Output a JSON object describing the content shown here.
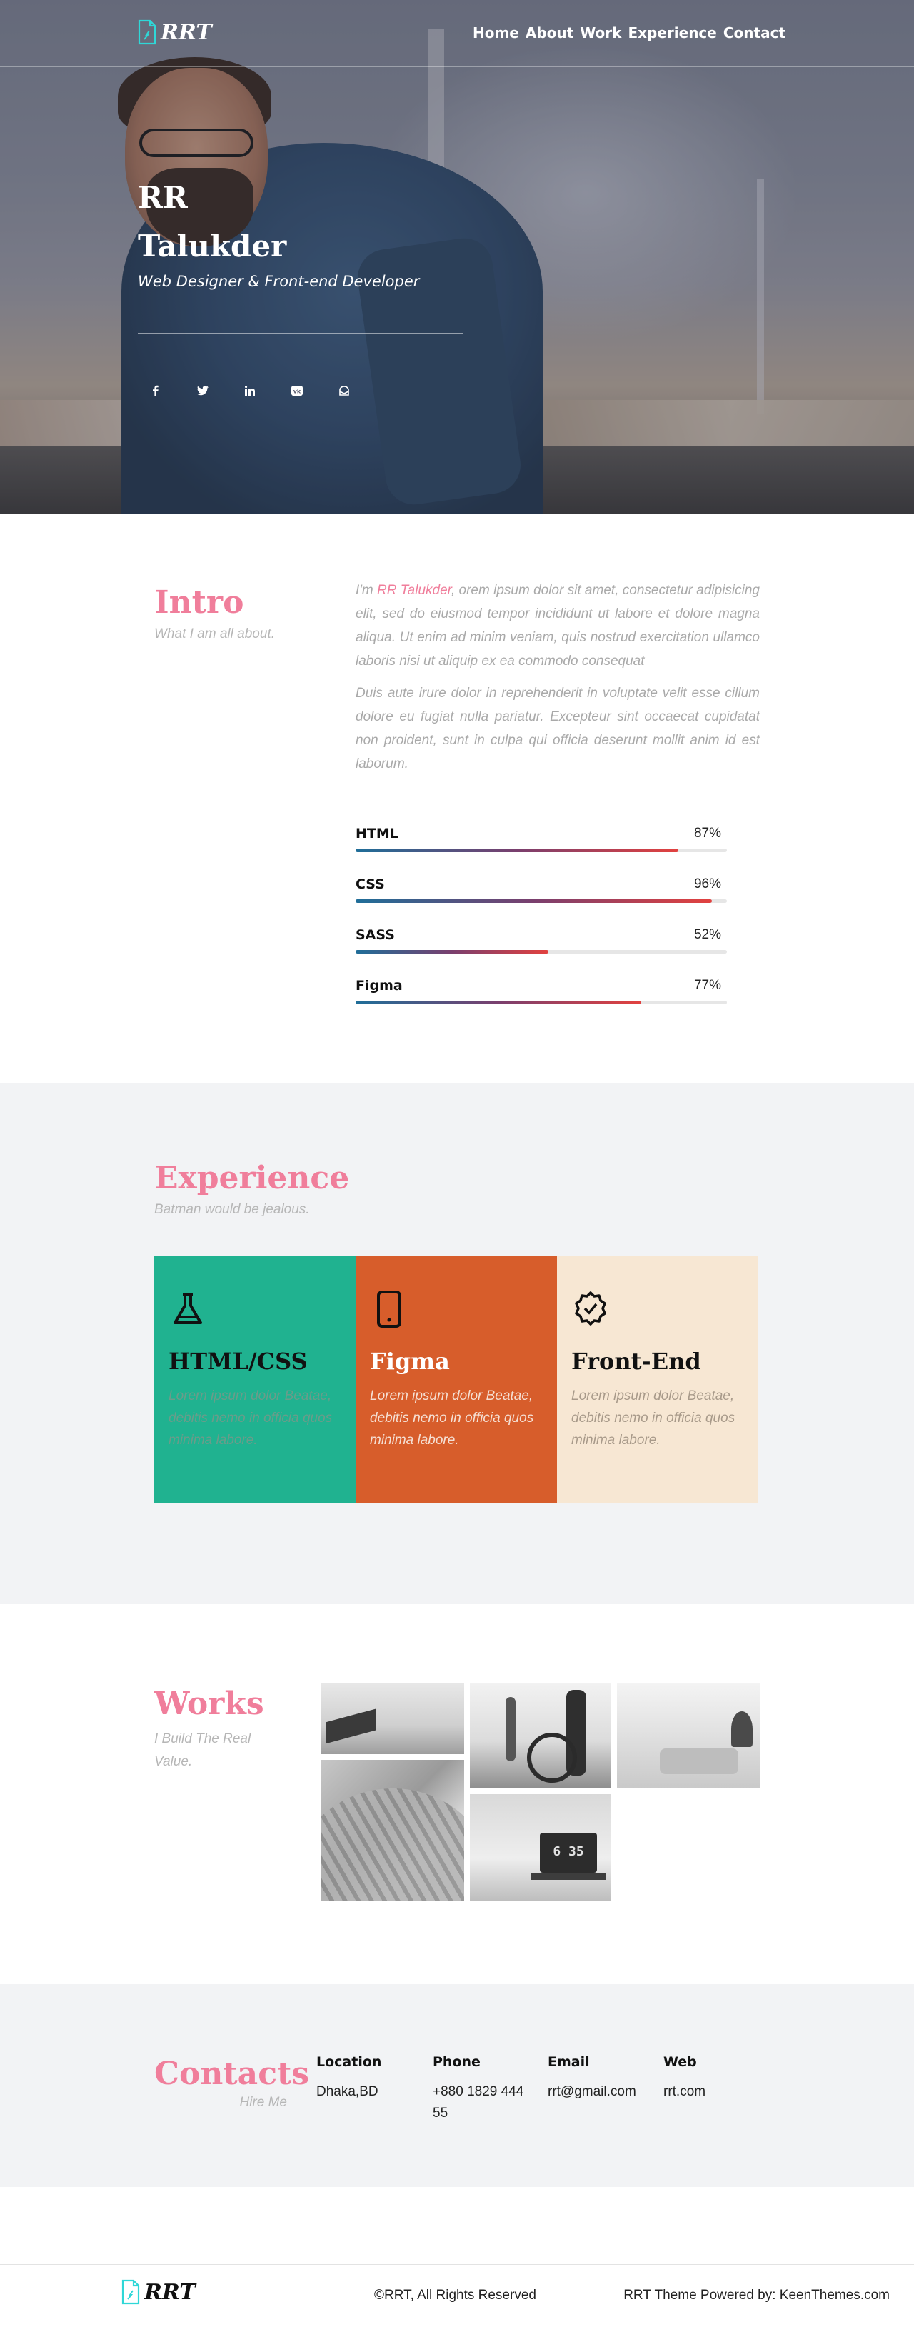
{
  "brand": {
    "logo_text": "RRT",
    "accent": "#f07e9b"
  },
  "nav": {
    "items": [
      "Home",
      "About",
      "Work",
      "Experience",
      "Contact"
    ]
  },
  "hero": {
    "name_line1": "RR",
    "name_line2": "Talukder",
    "role": "Web Designer & Front-end Developer",
    "socials": [
      "facebook-icon",
      "twitter-icon",
      "linkedin-icon",
      "vk-icon",
      "mail-icon"
    ]
  },
  "intro": {
    "title": "Intro",
    "subtitle": "What I am all about.",
    "para1_prefix": "I'm ",
    "para1_highlight": "RR Talukder",
    "para1_rest": ", orem ipsum dolor sit amet, consectetur adipisicing elit, sed do eiusmod tempor incididunt ut labore et dolore magna aliqua. Ut enim ad minim veniam, quis nostrud exercitation ullamco laboris nisi ut aliquip ex ea commodo consequat",
    "para2": "Duis aute irure dolor in reprehenderit in voluptate velit esse cillum dolore eu fugiat nulla pariatur. Excepteur sint occaecat cupidatat non proident, sunt in culpa qui officia deserunt mollit anim id est laborum.",
    "skills": [
      {
        "name": "HTML",
        "percent_label": "87%",
        "value": 87
      },
      {
        "name": "CSS",
        "percent_label": "96%",
        "value": 96
      },
      {
        "name": "SASS",
        "percent_label": "52%",
        "value": 52
      },
      {
        "name": "Figma",
        "percent_label": "77%",
        "value": 77
      }
    ]
  },
  "experience": {
    "title": "Experience",
    "subtitle": "Batman would be jealous.",
    "cards": [
      {
        "icon": "flask-icon",
        "title": "HTML/CSS",
        "text": "Lorem ipsum dolor Beatae, debitis nemo in officia quos minima labore.",
        "color": "#20b290"
      },
      {
        "icon": "tablet-icon",
        "title": "Figma",
        "text": "Lorem ipsum dolor Beatae, debitis nemo in officia quos minima labore.",
        "color": "#d75d2b"
      },
      {
        "icon": "badge-check-icon",
        "title": "Front-End",
        "text": "Lorem ipsum dolor Beatae, debitis nemo in officia quos minima labore.",
        "color": "#f7e7d3"
      }
    ]
  },
  "works": {
    "title": "Works",
    "subtitle_line1": "I Build The Real",
    "subtitle_line2": "Value.",
    "laptop_clock": "6 35"
  },
  "contacts": {
    "title": "Contacts",
    "subtitle": "Hire Me",
    "location_label": "Location",
    "location_value": "Dhaka,BD",
    "phone_label": "Phone",
    "phone_line1": "+880 1829 444",
    "phone_line2": "55",
    "email_label": "Email",
    "email_value": "rrt@gmail.com",
    "web_label": "Web",
    "web_value": "rrt.com"
  },
  "footer": {
    "logo_text": "RRT",
    "copyright": "©RRT, All Rights Reserved",
    "powered": "RRT Theme Powered by: KeenThemes.com"
  }
}
